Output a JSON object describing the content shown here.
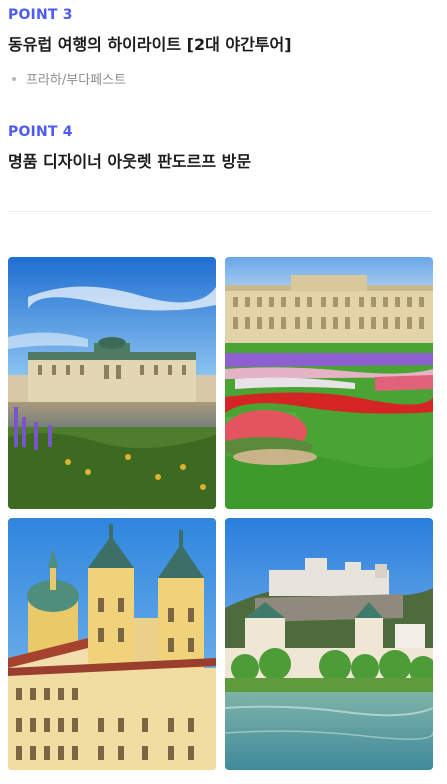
{
  "points": [
    {
      "label": "POINT 3",
      "title": "동유럽 여행의 하이라이트 [2대 야간투어]",
      "sub": "프라하/부다페스트"
    },
    {
      "label": "POINT 4",
      "title": "명품 디자이너 아웃렛 판도르프 방문"
    }
  ],
  "gallery": {
    "photos": [
      {
        "id": "belvedere-palace-photo"
      },
      {
        "id": "schonbrunn-garden-photo"
      },
      {
        "id": "melk-abbey-photo"
      },
      {
        "id": "salzburg-fortress-photo"
      }
    ]
  },
  "colors": {
    "accent": "#4d5bf5",
    "sky": "#3f8fe0",
    "grass": "#3e9f2c"
  }
}
